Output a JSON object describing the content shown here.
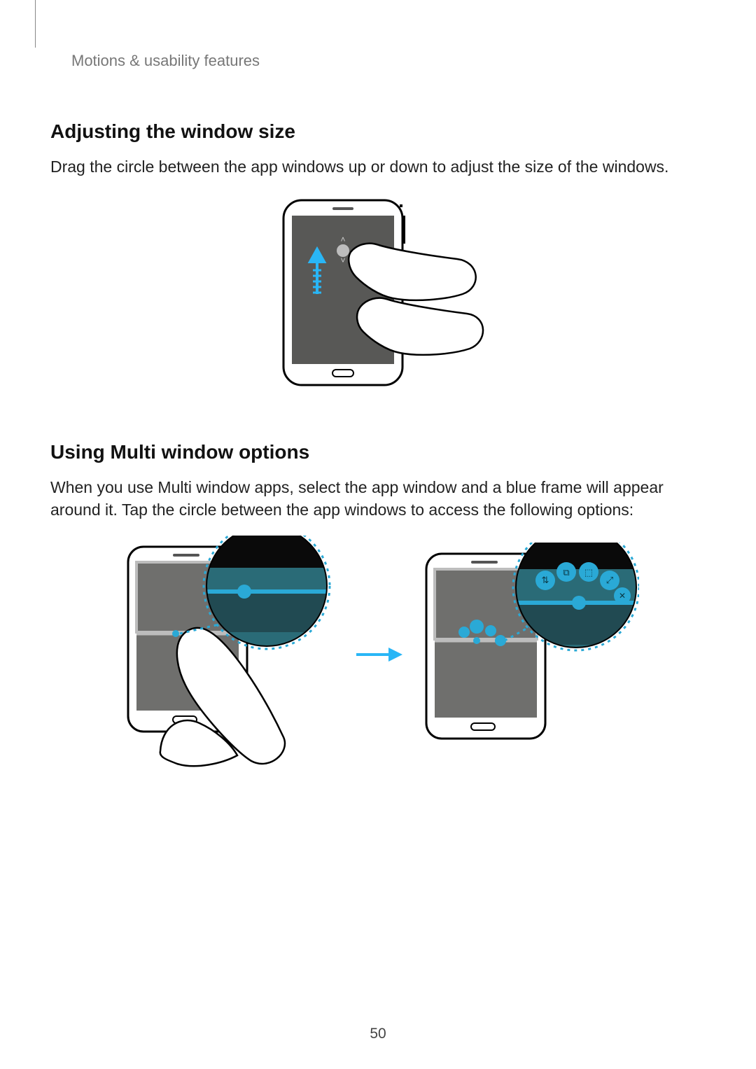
{
  "breadcrumb": "Motions & usability features",
  "section1": {
    "title": "Adjusting the window size",
    "body": "Drag the circle between the app windows up or down to adjust the size of the windows."
  },
  "section2": {
    "title": "Using Multi window options",
    "body": "When you use Multi window apps, select the app window and a blue frame will appear around it. Tap the circle between the app windows to access the following options:"
  },
  "page_number": "50"
}
